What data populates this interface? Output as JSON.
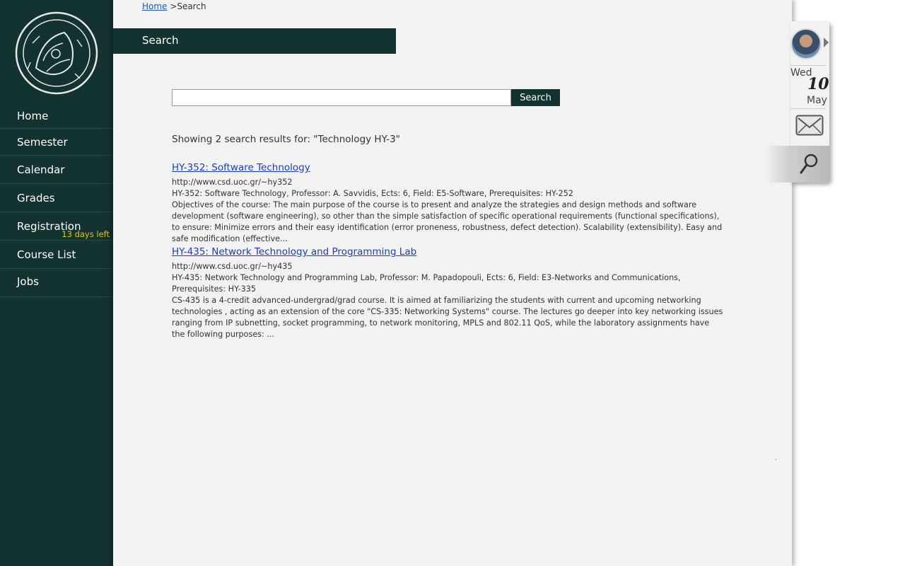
{
  "breadcrumb": {
    "home": "Home",
    "separator": ">",
    "current": "Search"
  },
  "page_title": "Search",
  "sidebar": {
    "items": [
      {
        "label": "Home"
      },
      {
        "label": "Semester"
      },
      {
        "label": "Calendar"
      },
      {
        "label": "Grades"
      },
      {
        "label": "Registration",
        "badge": "13 days left"
      },
      {
        "label": "Course List"
      },
      {
        "label": "Jobs"
      }
    ]
  },
  "search": {
    "value": "",
    "placeholder": "",
    "button_label": "Search"
  },
  "summary": "Showing 2 search results for: \"Technology HY-3\"",
  "results": [
    {
      "title": "HY-352: Software Technology",
      "url": "http://www.csd.uoc.gr/~hy352",
      "meta": "HY-352: Software Technology, Professor: A. Savvidis, Ects: 6, Field: E5-Software, Prerequisites: HY-252",
      "description": "Objectives of the course: The main purpose of the course is to present and analyze the strategies and design methods and software development (software engineering), so other than the simple satisfaction of specific operational requirements (functional specifications), to ensure: Minimize errors and their easy identification (error proneness, robustness, defect detection). Scalability (extensibility). Easy and safe modification (effective..."
    },
    {
      "title": "HY-435: Network Technology and Programming Lab",
      "url": "http://www.csd.uoc.gr/~hy435",
      "meta": "HY-435:  Network Technology and Programming Lab, Professor: M. Papadopouli, Ects: 6, Field: E3-Networks and Communications, Prerequisites: HY-335",
      "description": "CS-435 is a 4-credit advanced-undergrad/grad course. It is aimed at familiarizing the students with current and upcoming networking technologies , acting as an extension of the core \"CS-335: Networking Systems\" course. The lectures go deeper into key networking issues ranging from IP subnetting, socket programming, to network monitoring, MPLS and 802.11 QoS, while the laboratory assignments have the following purposes: ..."
    }
  ],
  "widget": {
    "day_name": "Wed",
    "day_number": "10",
    "month": "May"
  },
  "colors": {
    "sidebar": "#123330",
    "accent_link": "#1a3ccc",
    "badge": "#e8c200",
    "background": "#f2f2f2"
  },
  "icons": {
    "logo": "university-seal-logo",
    "mail": "mail-icon",
    "search": "magnifier-icon"
  }
}
